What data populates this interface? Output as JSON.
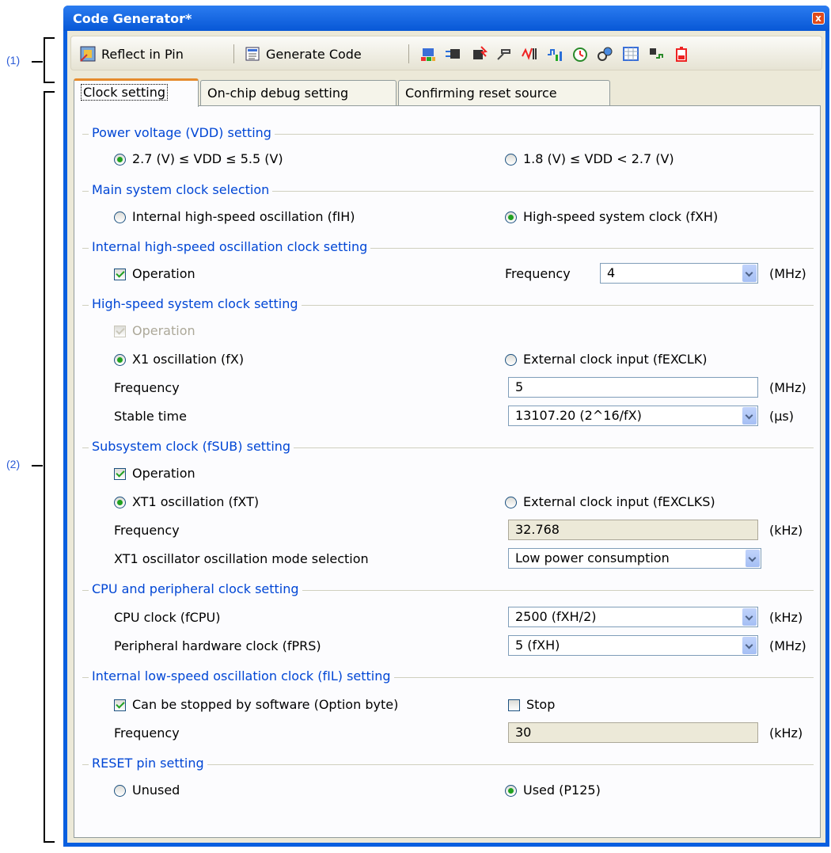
{
  "callouts": {
    "one": "(1)",
    "two": "(2)"
  },
  "window": {
    "title": "Code Generator*",
    "close": "x"
  },
  "toolbar": {
    "reflect_label": "Reflect in Pin",
    "generate_label": "Generate Code",
    "icons": [
      "pin-config-icon",
      "port-icon",
      "interrupt-icon",
      "serial-icon",
      "adc-icon",
      "timer-icon",
      "watchdog-icon",
      "key-icon",
      "grid-icon",
      "realtime-clock-icon",
      "battery-icon"
    ]
  },
  "tabs": [
    "Clock setting",
    "On-chip debug setting",
    "Confirming reset source"
  ],
  "sections": {
    "power": "Power voltage (VDD) setting",
    "main_clock": "Main system clock selection",
    "ih_osc": "Internal high-speed oscillation clock setting",
    "hs_clock": "High-speed system clock setting",
    "sub_clock": "Subsystem clock (fSUB) setting",
    "cpu_clock": "CPU and peripheral clock setting",
    "il_osc": "Internal low-speed oscillation clock (fIL) setting",
    "reset_pin": "RESET pin setting"
  },
  "power": {
    "opt1": "2.7 (V) ≤ VDD ≤ 5.5 (V)",
    "opt2": "1.8 (V) ≤ VDD < 2.7 (V)"
  },
  "main_clock": {
    "opt1": "Internal high-speed oscillation (fIH)",
    "opt2": "High-speed system clock (fXH)"
  },
  "ih_osc": {
    "operation": "Operation",
    "freq_label": "Frequency",
    "freq_value": "4",
    "unit": "(MHz)"
  },
  "hs_clock": {
    "operation": "Operation",
    "opt1": "X1 oscillation (fX)",
    "opt2": "External clock input (fEXCLK)",
    "freq_label": "Frequency",
    "freq_value": "5",
    "freq_unit": "(MHz)",
    "stable_label": "Stable time",
    "stable_value": "13107.20 (2^16/fX)",
    "stable_unit": "(µs)"
  },
  "sub_clock": {
    "operation": "Operation",
    "opt1": "XT1 oscillation (fXT)",
    "opt2": "External clock input (fEXCLKS)",
    "freq_label": "Frequency",
    "freq_value": "32.768",
    "freq_unit": "(kHz)",
    "mode_label": "XT1 oscillator oscillation mode selection",
    "mode_value": "Low power consumption"
  },
  "cpu_clock": {
    "cpu_label": "CPU clock (fCPU)",
    "cpu_value": "2500 (fXH/2)",
    "cpu_unit": "(kHz)",
    "prs_label": "Peripheral hardware clock (fPRS)",
    "prs_value": "5 (fXH)",
    "prs_unit": "(MHz)"
  },
  "il_osc": {
    "can_stop": "Can be stopped by software (Option byte)",
    "stop": "Stop",
    "freq_label": "Frequency",
    "freq_value": "30",
    "freq_unit": "(kHz)"
  },
  "reset_pin": {
    "opt1": "Unused",
    "opt2": "Used (P125)"
  }
}
